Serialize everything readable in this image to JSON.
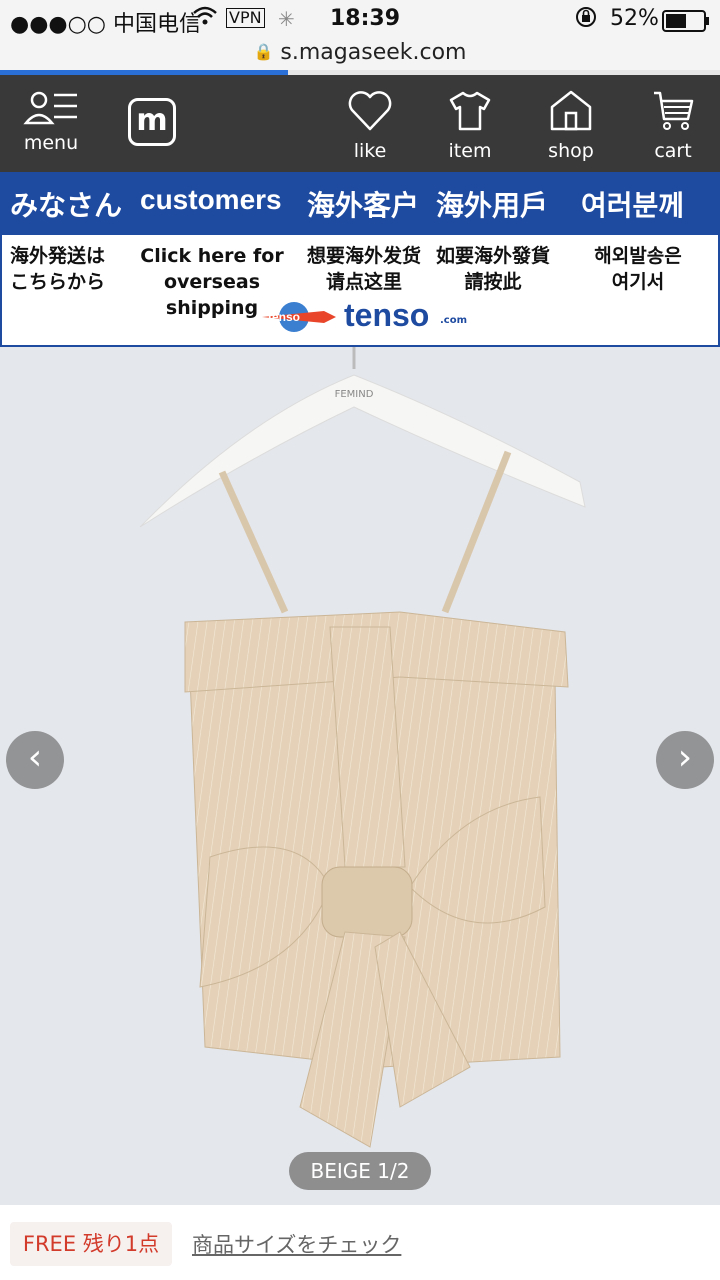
{
  "status_bar": {
    "carrier": "●●●○○ 中国电信",
    "vpn": "VPN",
    "time": "18:39",
    "battery": "52%"
  },
  "browser": {
    "url": "s.magaseek.com",
    "load_progress": 0.4
  },
  "nav": {
    "menu_label": "menu",
    "like_label": "like",
    "item_label": "item",
    "shop_label": "shop",
    "cart_label": "cart",
    "logo_letter": "m"
  },
  "banner": {
    "jp": "みなさん",
    "en": "customers",
    "zh_cn": "海外客户",
    "zh_tw": "海外用戶",
    "ko": "여러분께"
  },
  "shipping": {
    "jp_line1": "海外発送は",
    "jp_line2": "こちらから",
    "en_line1": "Click here for",
    "en_line2": "overseas shipping",
    "cn_line1": "想要海外发货",
    "cn_line2": "请点这里",
    "tw_line1": "如要海外發貨",
    "tw_line2": "請按此",
    "ko_line1": "해외발송은",
    "ko_line2": "여기서",
    "tenso_logo": "tenso",
    "tenso_suffix": ".com"
  },
  "product": {
    "hanger_brand": "FEMIND",
    "pager": "BEIGE  1/2"
  },
  "bottom": {
    "badge": "FREE 残り1点",
    "size_link": "商品サイズをチェック"
  },
  "colors": {
    "nav_bg": "#282828",
    "banner_blue": "#1e4aa0",
    "garment": "#e6d4bc",
    "accent_red": "#d23a2a"
  }
}
